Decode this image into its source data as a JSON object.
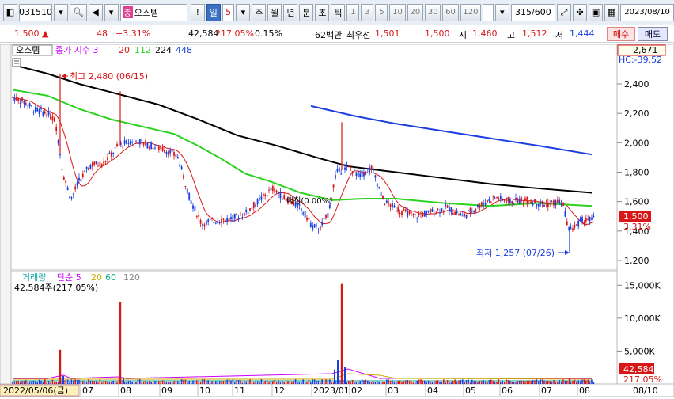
{
  "toolbar": {
    "code": "031510",
    "badge": "종",
    "name": "오스템",
    "alert": "!",
    "period": "일",
    "period_num": "5",
    "periods": [
      "주",
      "월",
      "년",
      "분",
      "초",
      "틱"
    ],
    "intervals": [
      "1",
      "3",
      "5",
      "10",
      "20",
      "30",
      "60",
      "120"
    ],
    "count": "315/600",
    "date": "2023/08/10"
  },
  "quote": {
    "price": "1,500",
    "change": "48",
    "change_pct": "+3.31%",
    "volume": "42,584",
    "vol_ratio": "217.05%",
    "turnover": "0.15%",
    "amount": "62백만",
    "best_label": "최우선",
    "best_ask": "1,501",
    "best_bid": "1,500",
    "open_label": "시",
    "open": "1,460",
    "high_label": "고",
    "high": "1,512",
    "low_label": "저",
    "low": "1,444",
    "buy": "매수",
    "sell": "매도"
  },
  "price_panel": {
    "legend_name": "오스템",
    "legend_ma": "종가 지수 3",
    "ma_periods": [
      "20",
      "112",
      "224",
      "448"
    ],
    "top_value": "2,671",
    "hc_label": "HC:-39.52",
    "last_price": "1,500",
    "last_pct": "3.31%",
    "high_annotation": "최고 2,480 (06/15)",
    "low_annotation": "최저 1,257 (07/26)",
    "mid_annotation": "매칭(0.00%)",
    "y_ticks": [
      "2,400",
      "2,200",
      "2,000",
      "1,800",
      "1,600",
      "1,400",
      "1,200"
    ]
  },
  "volume_panel": {
    "legend_name": "거래량",
    "legend_ma": "단순 5",
    "ma_periods": [
      "20",
      "60",
      "120"
    ],
    "current": "42,584주(217.05%)",
    "y_ticks": [
      "15,000K",
      "10,000K",
      "5,000K"
    ],
    "last_volume": "42,584",
    "last_pct": "217.05%"
  },
  "x_axis": {
    "start_label": "2022/05/06(금)",
    "labels": [
      "07",
      "08",
      "09",
      "10",
      "11",
      "12",
      "2023/01",
      "02",
      "03",
      "04",
      "05",
      "06",
      "07",
      "08"
    ],
    "right_label": "08/10"
  },
  "colors": {
    "up": "#d81818",
    "down": "#1a3ee0",
    "ma20": "#d81818",
    "ma112": "#2bd21f",
    "ma224": "#000000",
    "ma448": "#1a3ee0"
  }
}
